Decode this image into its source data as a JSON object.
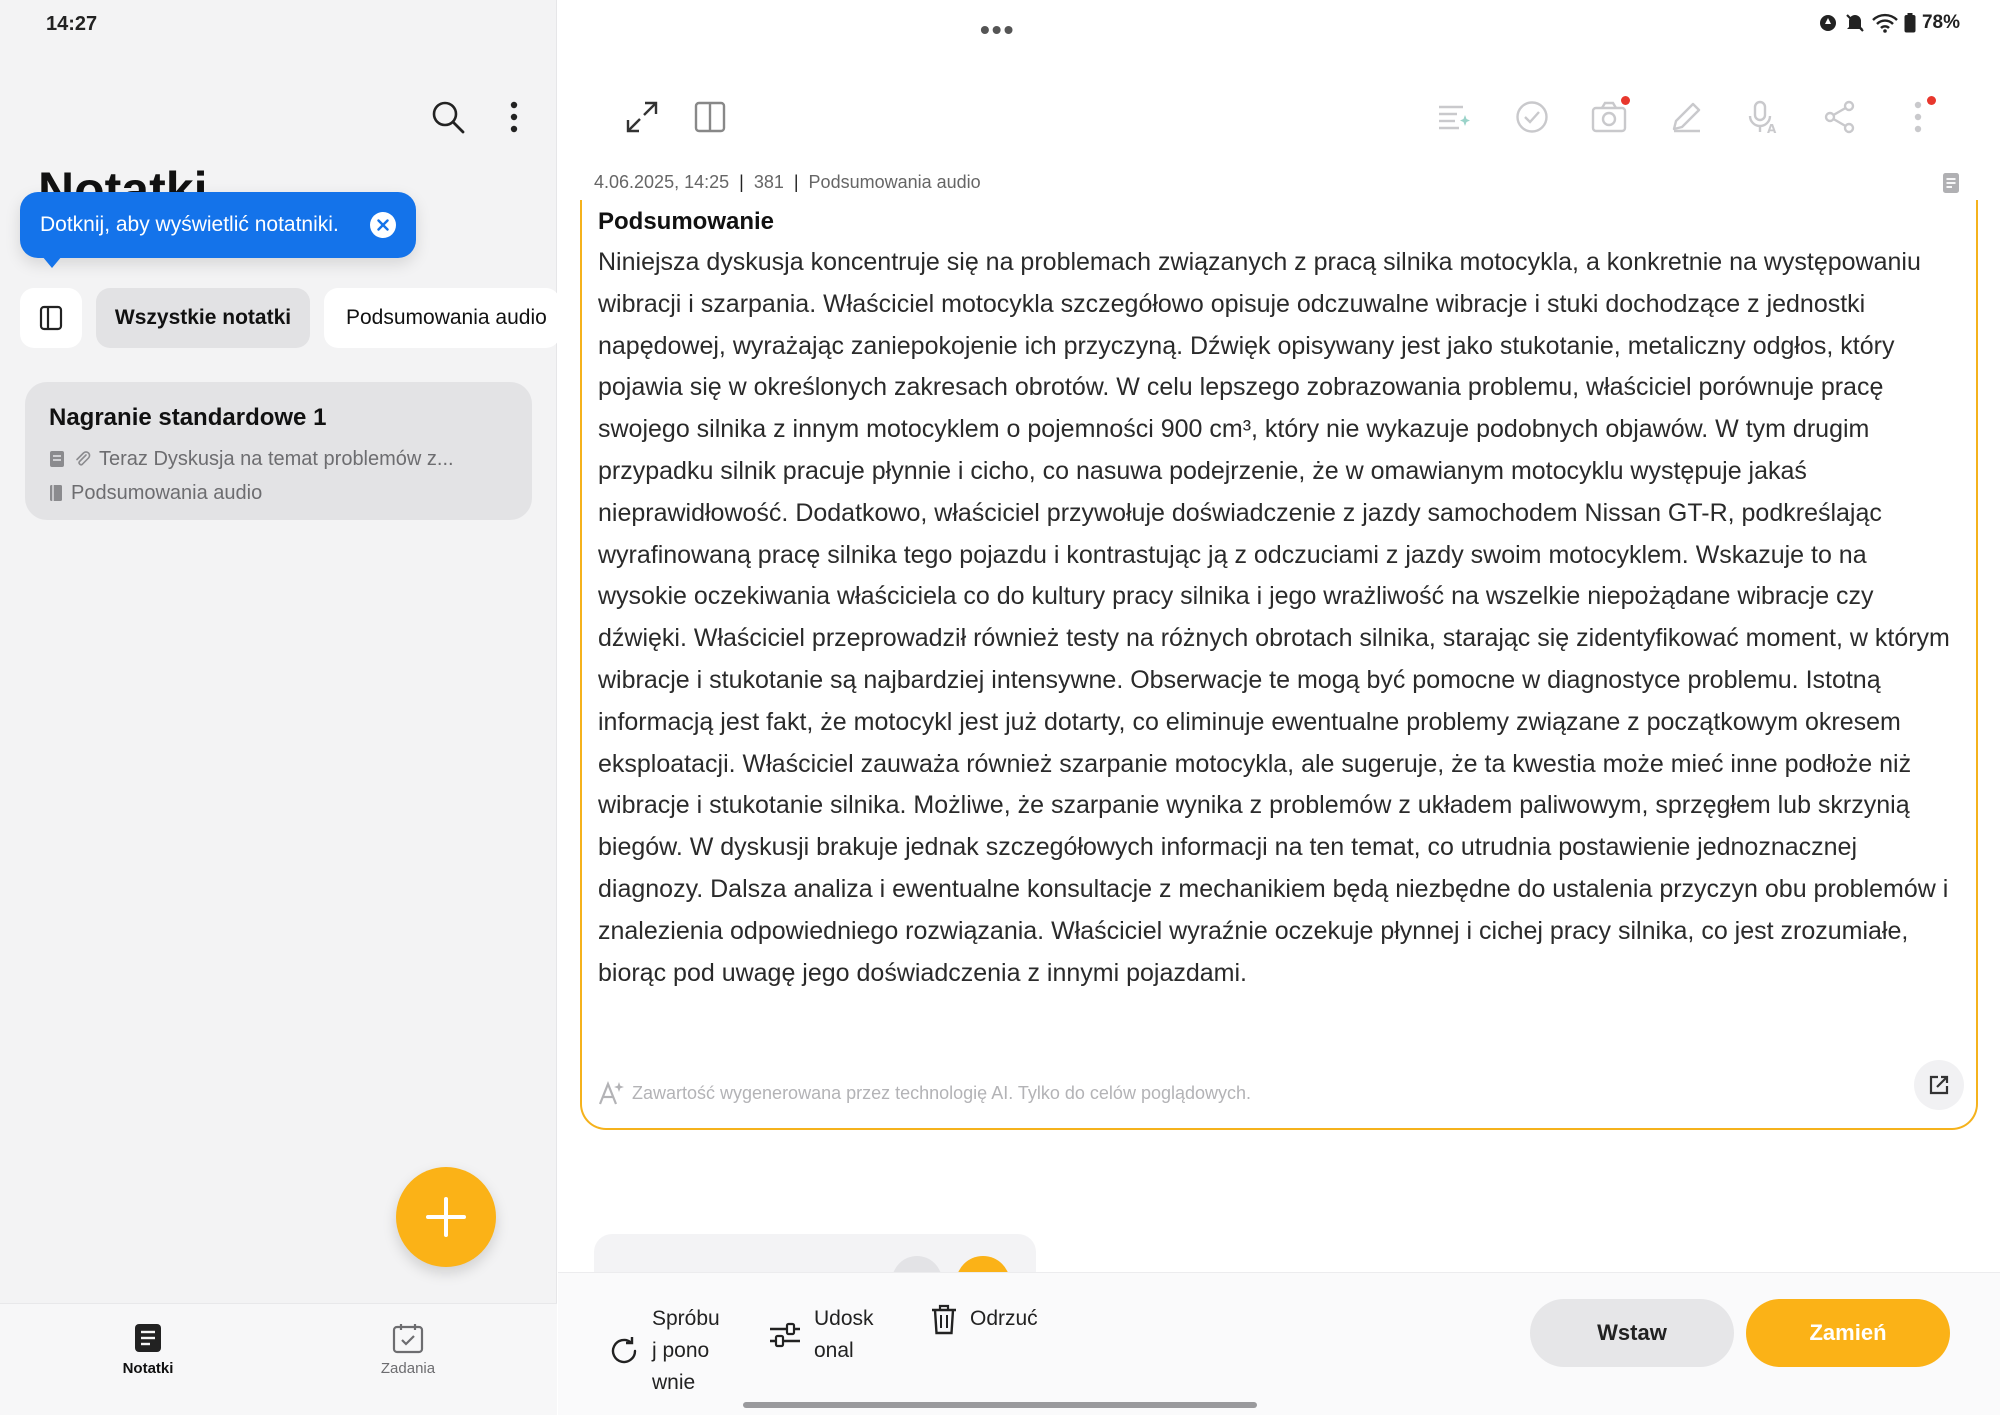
{
  "status_bar": {
    "time": "14:27",
    "battery": "78%"
  },
  "sidebar": {
    "heading": "Notatki",
    "tooltip": "Dotknij, aby wyświetlić notatniki.",
    "chips": [
      "Wszystkie notatki",
      "Podsumowania audio"
    ],
    "note": {
      "title": "Nagranie standardowe 1",
      "preview": "Teraz Dyskusja na temat problemów z...",
      "folder": "Podsumowania audio"
    },
    "nav": {
      "notes": "Notatki",
      "tasks": "Zadania"
    }
  },
  "editor": {
    "meta": {
      "date": "4.06.2025, 14:25",
      "count": "381",
      "category": "Podsumowania audio"
    },
    "summary_heading": "Podsumowanie",
    "summary_text": "Niniejsza dyskusja koncentruje się na problemach związanych z pracą silnika motocykla, a konkretnie na występowaniu wibracji i szarpania.  Właściciel motocykla szczegółowo opisuje odczuwalne wibracje i stuki dochodzące z jednostki napędowej, wyrażając zaniepokojenie ich przyczyną.  Dźwięk opisywany jest jako stukotanie, metaliczny odgłos, który pojawia się w określonych zakresach obrotów.  W celu lepszego zobrazowania problemu, właściciel porównuje pracę swojego silnika z innym motocyklem o pojemności 900 cm³, który nie wykazuje podobnych objawów.  W tym drugim przypadku silnik pracuje płynnie i cicho, co nasuwa podejrzenie, że w omawianym motocyklu występuje jakaś nieprawidłowość.  Dodatkowo, właściciel przywołuje doświadczenie z jazdy samochodem Nissan GT-R, podkreślając wyrafinowaną pracę silnika tego pojazdu i kontrastując ją z odczuciami z jazdy swoim motocyklem.  Wskazuje to na wysokie oczekiwania właściciela co do kultury pracy silnika i jego wrażliwość na wszelkie niepożądane wibracje czy dźwięki.  Właściciel przeprowadził również testy na różnych obrotach silnika, starając się zidentyfikować moment, w którym wibracje i stukotanie są najbardziej intensywne.  Obserwacje te mogą być pomocne w diagnostyce problemu.  Istotną informacją jest fakt, że motocykl jest już dotarty, co eliminuje ewentualne problemy związane z początkowym okresem eksploatacji.  Właściciel zauważa również szarpanie motocykla, ale sugeruje, że ta kwestia może mieć inne podłoże niż wibracje i stukotanie silnika.  Możliwe, że szarpanie wynika z problemów z układem paliwowym, sprzęgłem lub skrzynią biegów.  W dyskusji brakuje jednak szczegółowych informacji na ten temat, co utrudnia postawienie jednoznacznej diagnozy.  Dalsza analiza i ewentualne konsultacje z mechanikiem będą niezbędne do ustalenia przyczyn obu problemów i znalezienia odpowiedniego rozwiązania.  Właściciel wyraźnie oczekuje płynnej i cichej pracy silnika, co jest zrozumiałe, biorąc pod uwagę jego doświadczenia z innymi pojazdami.",
    "ai_disclaimer": "Zawartość wygenerowana przez technologię AI. Tylko do celów poglądowych."
  },
  "actions": {
    "retry": "Spróbuj ponownie",
    "refine": "Udoskonal",
    "discard": "Odrzuć",
    "insert": "Wstaw",
    "replace": "Zamień"
  },
  "colors": {
    "accent": "#fbb217",
    "tooltip": "#1473ea",
    "notification_dot": "#e8372d"
  }
}
